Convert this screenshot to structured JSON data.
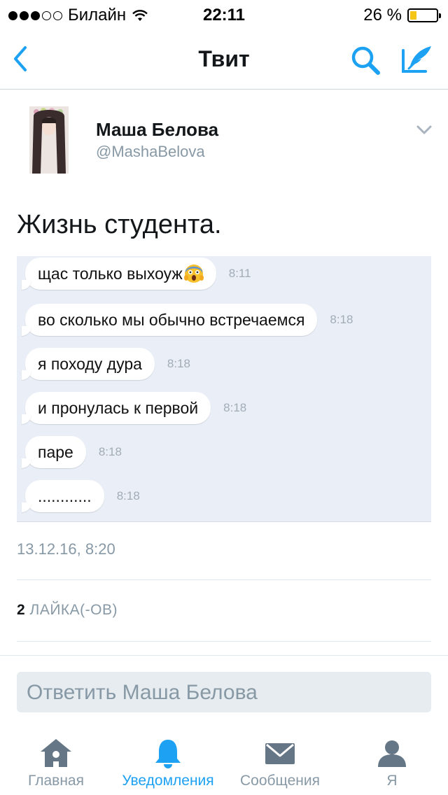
{
  "status_bar": {
    "carrier": "Билайн",
    "time": "22:11",
    "battery": "26 %",
    "battery_level": 0.26,
    "signal_bars_filled": 3,
    "signal_bars_total": 5
  },
  "nav": {
    "title": "Твит",
    "back_icon": "chevron-left-icon",
    "search_icon": "search-icon",
    "compose_icon": "compose-icon"
  },
  "tweet": {
    "user_name": "Маша Белова",
    "user_handle": "@MashaBelova",
    "text": "Жизнь студента.",
    "date": "13.12.16, 8:20",
    "likes_count": "2",
    "likes_label": "ЛАЙКА(-ОВ)"
  },
  "media": {
    "messages": [
      {
        "text": "щас только выхоуж",
        "emoji": "scream-emoji",
        "time": "8:11"
      },
      {
        "text": "во сколько мы обычно встречаемся",
        "time": "8:18"
      },
      {
        "text": "я походу дура",
        "time": "8:18"
      },
      {
        "text": "и пронулась к первой",
        "time": "8:18"
      },
      {
        "text": "паре",
        "time": "8:18"
      },
      {
        "text": "............",
        "time": "8:18"
      }
    ]
  },
  "reply": {
    "placeholder": "Ответить Маша Белова"
  },
  "tabs": [
    {
      "label": "Главная",
      "icon": "home-icon",
      "active": false
    },
    {
      "label": "Уведомления",
      "icon": "bell-icon",
      "active": true
    },
    {
      "label": "Сообщения",
      "icon": "envelope-icon",
      "active": false
    },
    {
      "label": "Я",
      "icon": "person-icon",
      "active": false
    }
  ],
  "colors": {
    "accent": "#1da1f2",
    "secondary_text": "#8899a6",
    "battery_fill": "#f5c518",
    "media_background": "#e9eef7"
  }
}
